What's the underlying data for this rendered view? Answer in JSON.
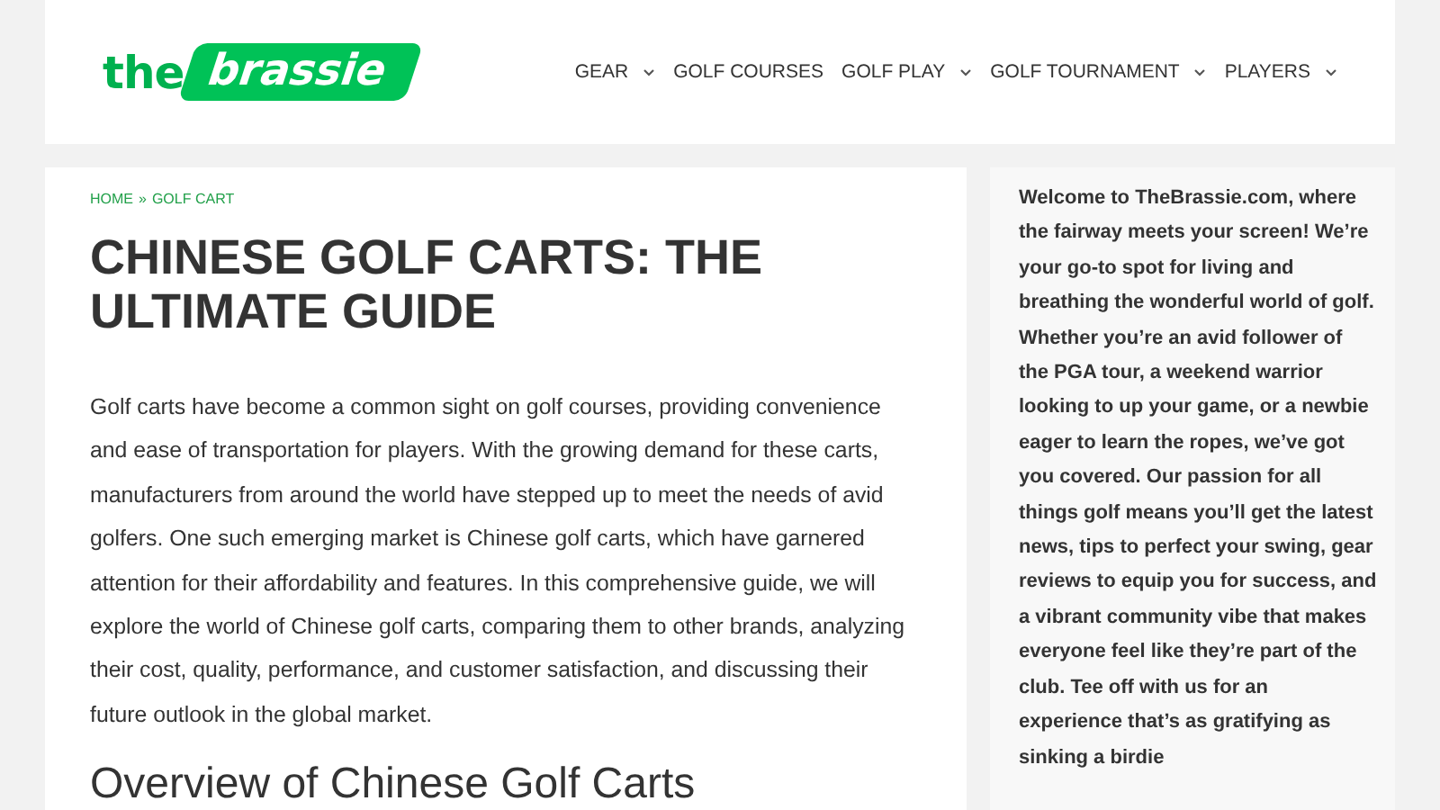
{
  "logo": {
    "prefix": "the",
    "name": "brassie"
  },
  "nav": [
    {
      "label": "GEAR",
      "dropdown": true
    },
    {
      "label": "GOLF COURSES",
      "dropdown": false
    },
    {
      "label": "GOLF PLAY",
      "dropdown": true
    },
    {
      "label": "GOLF TOURNAMENT",
      "dropdown": true
    },
    {
      "label": "PLAYERS",
      "dropdown": true
    }
  ],
  "breadcrumb": {
    "home": "HOME",
    "separator": "»",
    "current": "GOLF CART"
  },
  "article": {
    "title": "CHINESE GOLF CARTS: THE ULTIMATE GUIDE",
    "intro": "Golf carts have become a common sight on golf courses, providing convenience and ease of transportation for players. With the growing demand for these carts, manufacturers from around the world have stepped up to meet the needs of avid golfers. One such emerging market is Chinese golf carts, which have garnered attention for their affordability and features. In this comprehensive guide, we will explore the world of Chinese golf carts, comparing them to other brands, analyzing their cost, quality, performance, and customer satisfaction, and discussing their future outlook in the global market.",
    "heading": "Overview of Chinese Golf Carts"
  },
  "sidebar": {
    "about": "Welcome to TheBrassie.com, where the fairway meets your screen! We’re your go-to spot for living and breathing the wonderful world of golf. Whether you’re an avid follower of the PGA tour, a weekend warrior looking to up your game, or a newbie eager to learn the ropes, we’ve got you covered. Our passion for all things golf means you’ll get the latest news, tips to perfect your swing, gear reviews to equip you for success, and a vibrant community vibe that makes everyone feel like they’re part of the club. Tee off with us for an experience that’s as gratifying as sinking a birdie"
  }
}
